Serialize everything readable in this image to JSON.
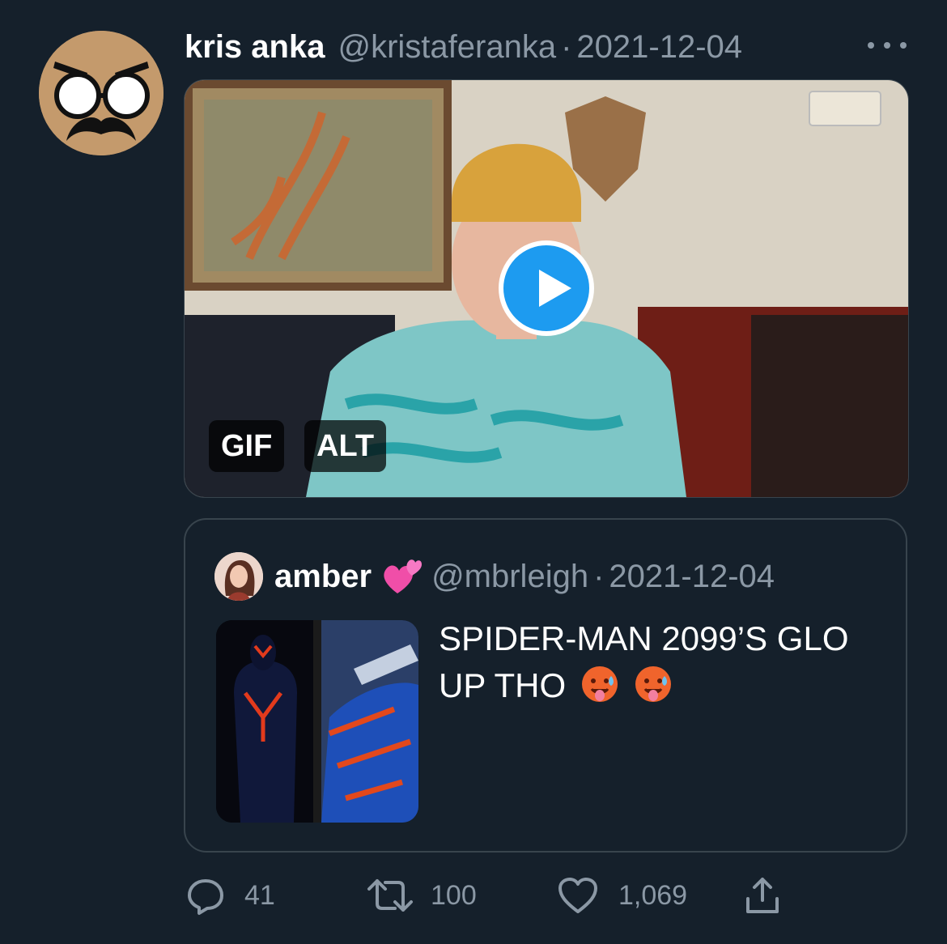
{
  "tweet": {
    "author_name": "kris anka",
    "author_handle": "@kristaferanka",
    "separator": "·",
    "date": "2021-12-04",
    "more_icon": "more-horizontal-icon",
    "media": {
      "type_badge": "GIF",
      "alt_badge": "ALT",
      "play_icon": "play-icon"
    }
  },
  "quote": {
    "author_name": "amber",
    "name_emoji": "heart-emoji",
    "author_handle": "@mbrleigh",
    "separator": "·",
    "date": "2021-12-04",
    "text": "SPIDER-MAN 2099’S GLO UP THO",
    "trailing_emojis": [
      "hot-face-emoji",
      "hot-face-emoji"
    ]
  },
  "actions": {
    "replies": "41",
    "retweets": "100",
    "likes": "1,069"
  },
  "colors": {
    "background": "#15202b",
    "secondary_text": "#8b98a5",
    "border": "#38444d",
    "accent": "#1d9bf0"
  }
}
